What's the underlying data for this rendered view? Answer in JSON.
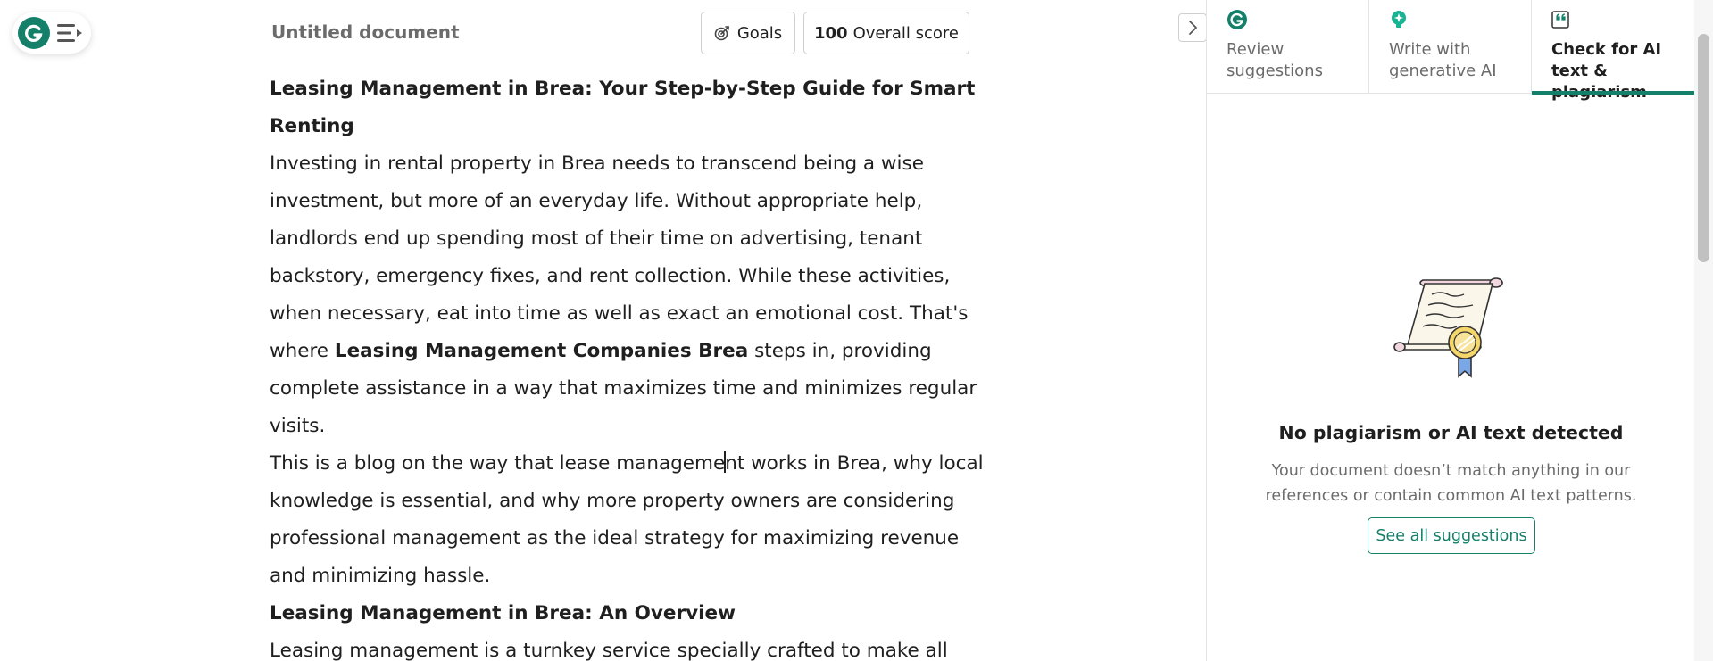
{
  "app": {
    "doc_title": "Untitled document"
  },
  "toolbar": {
    "goals_label": "Goals",
    "score_value": "100",
    "score_label": "Overall score"
  },
  "document": {
    "heading1": "Leasing Management in Brea: Your Step-by-Step Guide for Smart Renting",
    "para1_before": "Investing in rental property in Brea needs to transcend being a wise investment, but more of an everyday life. Without appropriate help, landlords end up spending most of their time on advertising, tenant backstory, emergency fixes, and rent collection. While these activities, when necessary, eat into time as well as exact an emotional cost. That's where ",
    "para1_bold": "Leasing Management Companies Brea",
    "para1_after": " steps in, providing complete assistance in a way that maximizes time and minimizes regular visits.",
    "para2_before_caret": "This is a blog on the way that lease manageme",
    "para2_after_caret": "nt works in Brea, why local knowledge is essential, and why more property owners are considering professional management as the ideal strategy for maximizing revenue and minimizing hassle.",
    "heading2": "Leasing Management in Brea: An Overview",
    "para3": "Leasing management is a turnkey service specially crafted to make all"
  },
  "panel": {
    "tabs": [
      {
        "label": "Review suggestions",
        "icon": "grammarly-g-icon",
        "active": false
      },
      {
        "label": "Write with generative AI",
        "icon": "lightbulb-icon",
        "active": false
      },
      {
        "label": "Check for AI text & plagiarism",
        "icon": "quote-icon",
        "active": true
      }
    ],
    "empty_title": "No plagiarism or AI text detected",
    "empty_text": "Your document doesn’t match anything in our references or contain common AI text patterns.",
    "see_all_label": "See all suggestions"
  },
  "colors": {
    "brand": "#15806a",
    "muted_text": "#6b6b6b",
    "body_text": "#1f1f1f"
  }
}
